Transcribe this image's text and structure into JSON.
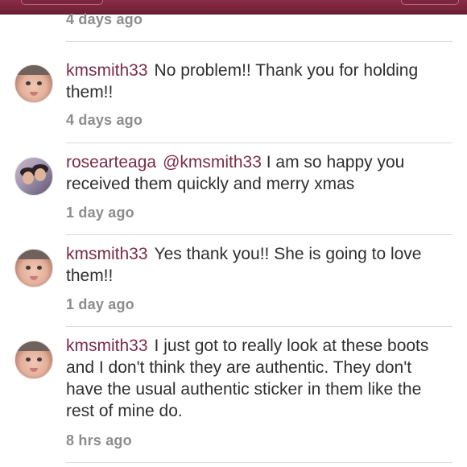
{
  "header": {
    "first_time": "4 days ago"
  },
  "comments": [
    {
      "username": "kmsmith33",
      "mention": "",
      "text": "No problem!! Thank you for holding them!!",
      "time": "4 days ago",
      "avatar": "baby-avatar"
    },
    {
      "username": "rosearteaga",
      "mention": "@kmsmith33",
      "text": " I am so happy you received them quickly and merry xmas",
      "time": "1 day ago",
      "avatar": "couple-avatar"
    },
    {
      "username": "kmsmith33",
      "mention": "",
      "text": "Yes thank you!! She is going to love them!!",
      "time": "1 day ago",
      "avatar": "baby-avatar"
    },
    {
      "username": "kmsmith33",
      "mention": "",
      "text": "I just got to really look at these boots and I don't think they are authentic. They don't have the usual authentic sticker in them like the rest of mine do.",
      "time": "8 hrs ago",
      "avatar": "baby-avatar"
    }
  ],
  "colors": {
    "header_bar": "#7c263d",
    "username": "#7b2c45",
    "timestamp": "#8c8c8c",
    "body_text": "#2f2f2f"
  }
}
